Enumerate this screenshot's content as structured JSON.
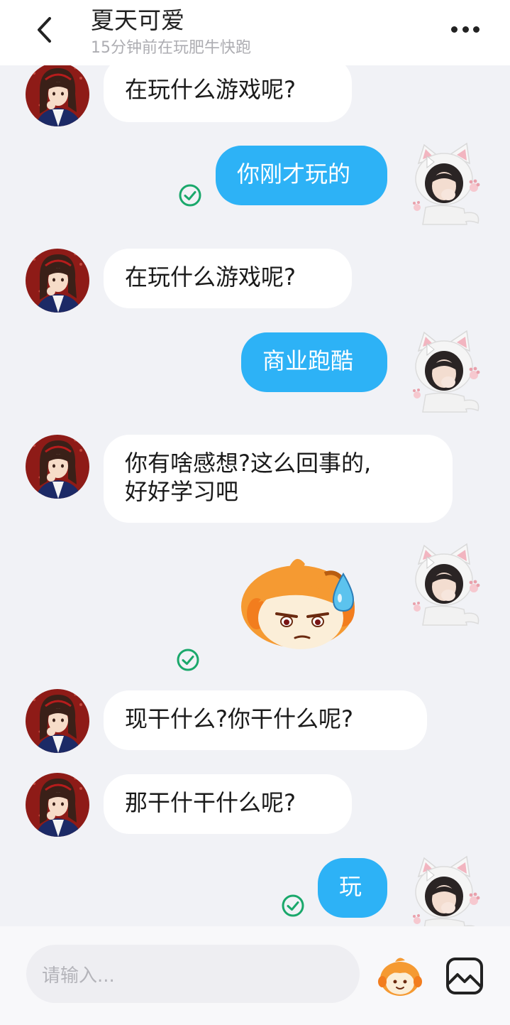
{
  "header": {
    "title": "夏天可爱",
    "status": "15分钟前在玩肥牛快跑",
    "back_icon": "chevron-left-icon",
    "more_icon": "more-horizontal-icon"
  },
  "messages": [
    {
      "from": "them",
      "text": "在玩什么游戏呢?"
    },
    {
      "from": "me",
      "text": "你刚才玩的",
      "read": true
    },
    {
      "from": "them",
      "text": "在玩什么游戏呢?"
    },
    {
      "from": "me",
      "text": "商业跑酷"
    },
    {
      "from": "them",
      "lines": [
        "你有啥感想?这么回事的,",
        "好好学习吧"
      ]
    },
    {
      "from": "me",
      "sticker": "sweat-face-sticker",
      "read": true
    },
    {
      "from": "them",
      "text": "现干什么?你干什么呢?"
    },
    {
      "from": "them",
      "text": "那干什干什么呢?"
    },
    {
      "from": "me",
      "text": "玩",
      "read": true
    }
  ],
  "input": {
    "placeholder": "请输入...",
    "emoji_icon": "emoji-sticker-icon",
    "image_icon": "image-icon"
  },
  "colors": {
    "outgoing_bubble": "#2db2f6",
    "incoming_bubble": "#ffffff",
    "background": "#f1f2f6",
    "read_check": "#1aa86b"
  }
}
